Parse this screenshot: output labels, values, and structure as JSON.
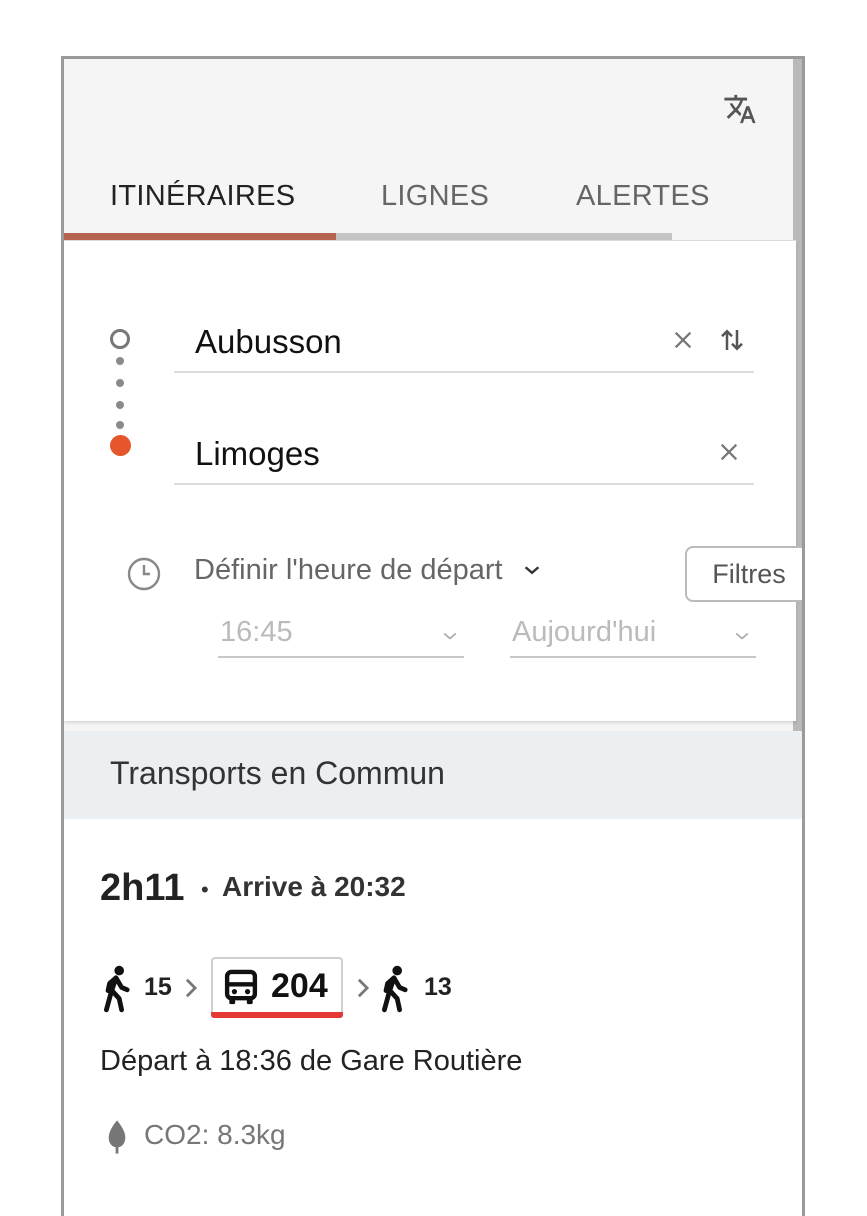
{
  "tabs": [
    {
      "label": "ITINÉRAIRES",
      "active": true
    },
    {
      "label": "LIGNES",
      "active": false
    },
    {
      "label": "ALERTES",
      "active": false
    }
  ],
  "colors": {
    "accent": "#b5654f",
    "inactive_bar": "#c4c4c4",
    "destination": "#e5562a",
    "bus_line": "#e53935"
  },
  "search": {
    "origin": "Aubusson",
    "destination": "Limoges"
  },
  "time": {
    "label": "Définir l'heure de départ",
    "filters_label": "Filtres",
    "time_value": "16:45",
    "date_value": "Aujourd'hui"
  },
  "section_title": "Transports en Commun",
  "result": {
    "duration": "2h11",
    "separator": "•",
    "arrival": "Arrive à 20:32",
    "walk_before": "15",
    "bus_line": "204",
    "walk_after": "13",
    "departure": "Départ à 18:36 de Gare Routière",
    "co2": "CO2: 8.3kg"
  },
  "icons": [
    "translate-icon",
    "clear-icon",
    "swap-icon",
    "clock-icon",
    "chevron-down-icon",
    "walk-icon",
    "bus-icon",
    "chevron-right-icon",
    "leaf-icon"
  ]
}
